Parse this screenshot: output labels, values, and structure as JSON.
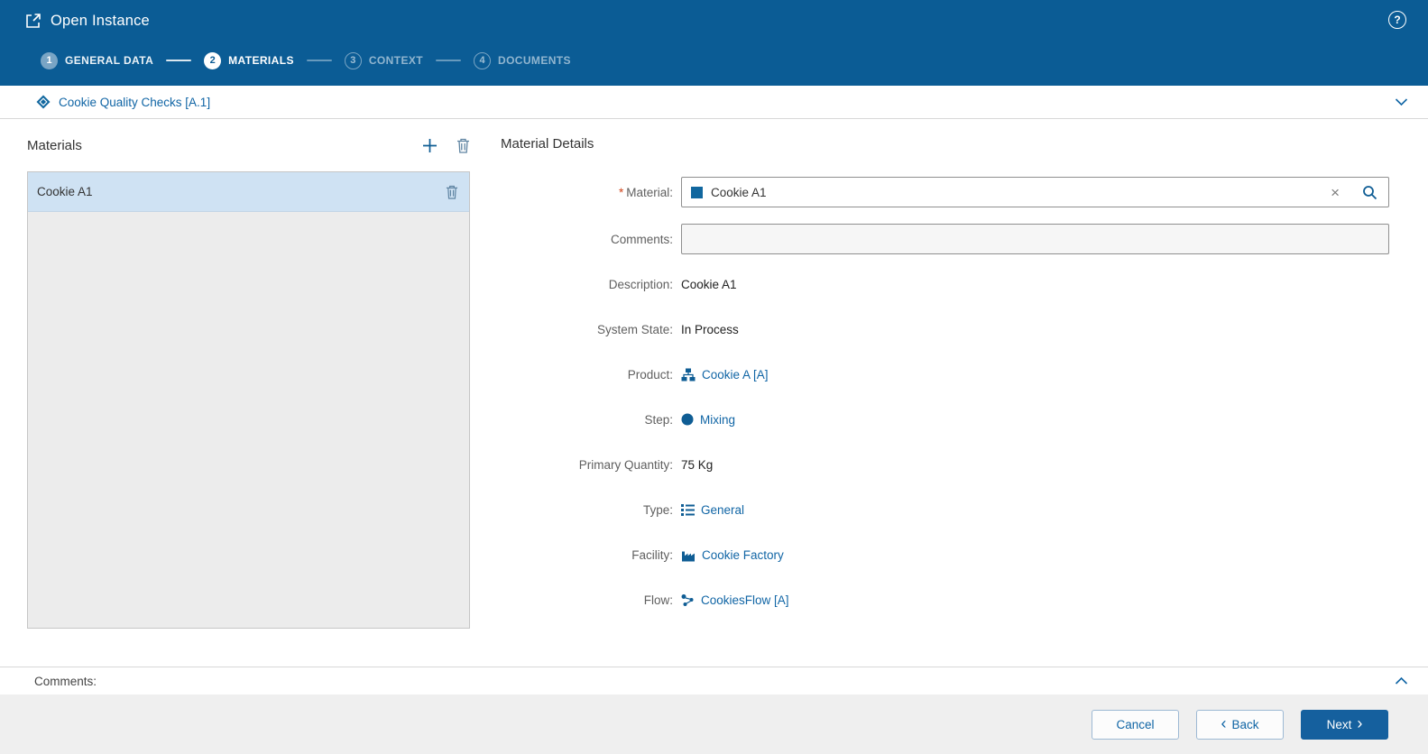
{
  "colors": {
    "header_bg": "#0b5c95",
    "link": "#1065a5",
    "selected_row_bg": "#cfe2f3",
    "primary_button_bg": "#15609e",
    "required_marker": "#d0451b"
  },
  "titlebar": {
    "title": "Open Instance",
    "icons": {
      "app": "open-instance-icon",
      "help": "help-icon"
    },
    "help_glyph": "?"
  },
  "stepper": {
    "steps": [
      {
        "number": "1",
        "label": "GENERAL DATA",
        "state": "completed"
      },
      {
        "number": "2",
        "label": "MATERIALS",
        "state": "active"
      },
      {
        "number": "3",
        "label": "CONTEXT",
        "state": "upcoming"
      },
      {
        "number": "4",
        "label": "DOCUMENTS",
        "state": "upcoming"
      }
    ]
  },
  "context_bar": {
    "link": "Cookie Quality Checks [A.1]",
    "icons": {
      "instance": "diamond-instance-icon",
      "collapse": "chevron-down-icon"
    }
  },
  "materials_panel": {
    "title": "Materials",
    "toolbar": {
      "add": "plus-icon",
      "delete": "trash-icon"
    },
    "items": [
      {
        "name": "Cookie A1",
        "selected": true
      }
    ]
  },
  "details_panel": {
    "title": "Material Details",
    "material_field": {
      "required_marker": "*",
      "label": "Material:",
      "value": "Cookie A1",
      "clear_glyph": "×",
      "icons": {
        "value": "material-square-icon",
        "clear": "close-icon",
        "search": "search-icon"
      }
    },
    "comments_field": {
      "label": "Comments:",
      "value": ""
    },
    "fields": [
      {
        "label": "Description:",
        "value": "Cookie A1",
        "type": "text"
      },
      {
        "label": "System State:",
        "value": "In Process",
        "type": "text"
      },
      {
        "label": "Product:",
        "value": "Cookie A [A]",
        "type": "link",
        "icon": "product-icon"
      },
      {
        "label": "Step:",
        "value": "Mixing",
        "type": "link",
        "icon": "step-icon"
      },
      {
        "label": "Primary Quantity:",
        "value": "75 Kg",
        "type": "text"
      },
      {
        "label": "Type:",
        "value": "General",
        "type": "link",
        "icon": "type-icon"
      },
      {
        "label": "Facility:",
        "value": "Cookie Factory",
        "type": "link",
        "icon": "facility-icon"
      },
      {
        "label": "Flow:",
        "value": "CookiesFlow [A]",
        "type": "link",
        "icon": "flow-icon"
      }
    ]
  },
  "comments_section": {
    "label": "Comments:",
    "icons": {
      "expand": "chevron-up-icon"
    }
  },
  "footer": {
    "cancel_label": "Cancel",
    "back_label": "Back",
    "next_label": "Next",
    "back_chevron": "‹",
    "next_chevron": "›"
  }
}
